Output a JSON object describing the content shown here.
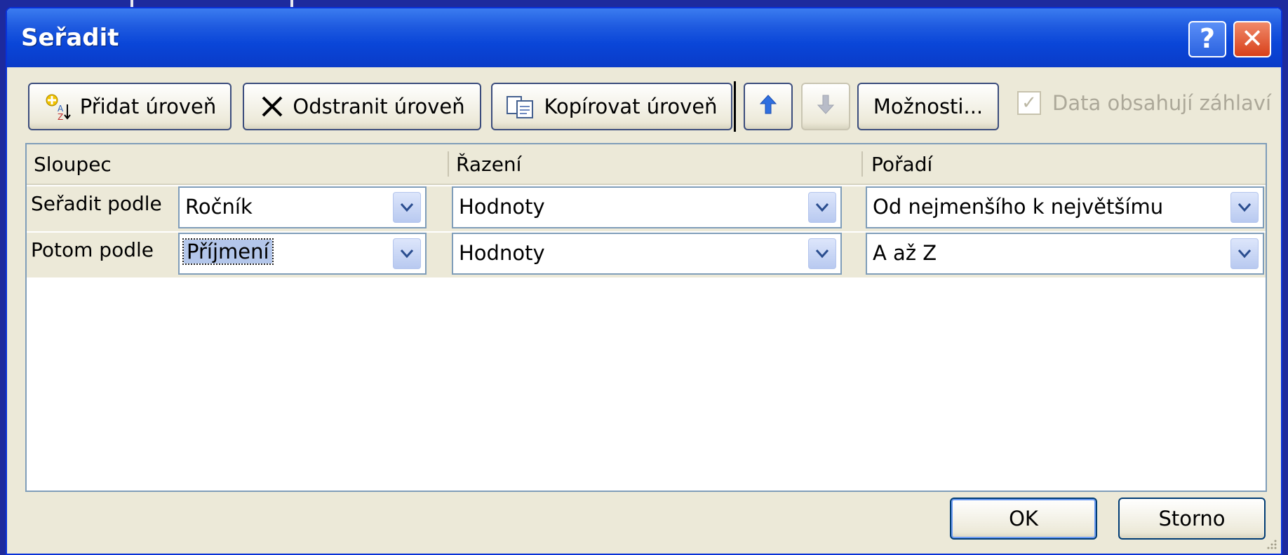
{
  "window": {
    "title": "Seřadit",
    "help_glyph": "?",
    "close_glyph": "✕"
  },
  "toolbar": {
    "add_level": "Přidat úroveň",
    "delete_level": "Odstranit úroveň",
    "copy_level": "Kopírovat úroveň",
    "move_up_icon": "arrow-up-icon",
    "move_down_icon": "arrow-down-icon",
    "options": "Možnosti...",
    "headers_checkbox_label": "Data obsahují záhlaví",
    "headers_checkbox_checked": true
  },
  "grid": {
    "headers": [
      "Sloupec",
      "Řazení",
      "Pořadí"
    ],
    "rows": [
      {
        "label": "Seřadit podle",
        "column": "Ročník",
        "sort_on": "Hodnoty",
        "order": "Od nejmenšího k největšímu"
      },
      {
        "label": "Potom podle",
        "column": "Příjmení",
        "sort_on": "Hodnoty",
        "order": "A až Z"
      }
    ]
  },
  "buttons": {
    "ok": "OK",
    "cancel": "Storno"
  },
  "colors": {
    "titlebar": "#0a46d8",
    "dialog_bg": "#ece9d8",
    "selection": "#b3c6ea"
  }
}
